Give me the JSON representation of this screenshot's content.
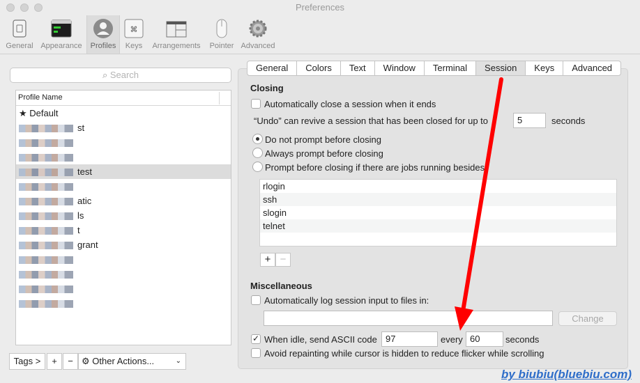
{
  "window": {
    "title": "Preferences"
  },
  "toolbar": {
    "items": [
      {
        "label": "General",
        "icon": "general-icon"
      },
      {
        "label": "Appearance",
        "icon": "appearance-icon"
      },
      {
        "label": "Profiles",
        "icon": "profiles-icon"
      },
      {
        "label": "Keys",
        "icon": "keys-icon"
      },
      {
        "label": "Arrangements",
        "icon": "arrangements-icon"
      },
      {
        "label": "Pointer",
        "icon": "pointer-icon"
      },
      {
        "label": "Advanced",
        "icon": "gear-icon"
      }
    ],
    "active": "Profiles"
  },
  "sidebar": {
    "search_placeholder": "Search",
    "column_header": "Profile Name",
    "profiles": [
      {
        "label": "★ Default"
      },
      {
        "label": "st"
      },
      {
        "label": ""
      },
      {
        "label": ""
      },
      {
        "label": "test",
        "selected": true
      },
      {
        "label": ""
      },
      {
        "label": "atic"
      },
      {
        "label": "ls"
      },
      {
        "label": "t"
      },
      {
        "label": "grant"
      },
      {
        "label": ""
      },
      {
        "label": ""
      },
      {
        "label": ""
      },
      {
        "label": ""
      }
    ],
    "tags_label": "Tags >",
    "add_label": "+",
    "remove_label": "−",
    "other_actions_label": "Other Actions..."
  },
  "tabs": [
    "General",
    "Colors",
    "Text",
    "Window",
    "Terminal",
    "Session",
    "Keys",
    "Advanced"
  ],
  "active_tab": "Session",
  "closing": {
    "title": "Closing",
    "auto_close_label": "Automatically close a session when it ends",
    "undo_label_prefix": "“Undo” can revive a session that has been closed for up to",
    "undo_seconds": "5",
    "undo_label_suffix": "seconds",
    "radio_options": [
      "Do not prompt before closing",
      "Always prompt before closing",
      "Prompt before closing if there are jobs running besides:"
    ],
    "jobs": [
      "rlogin",
      "ssh",
      "slogin",
      "telnet"
    ],
    "add_job": "+",
    "remove_job": "−"
  },
  "misc": {
    "title": "Miscellaneous",
    "log_label": "Automatically log session input to files in:",
    "log_path": "",
    "change_label": "Change",
    "idle_label": "When idle, send ASCII code",
    "idle_code": "97",
    "every_label": "every",
    "idle_every": "60",
    "seconds_label": "seconds",
    "repaint_label": "Avoid repainting while cursor is hidden to reduce flicker while scrolling"
  },
  "watermark": "by biubiu(bluebiu.com)",
  "colors": {
    "arrow": "#ff0000",
    "watermark": "#2f6ec9"
  }
}
